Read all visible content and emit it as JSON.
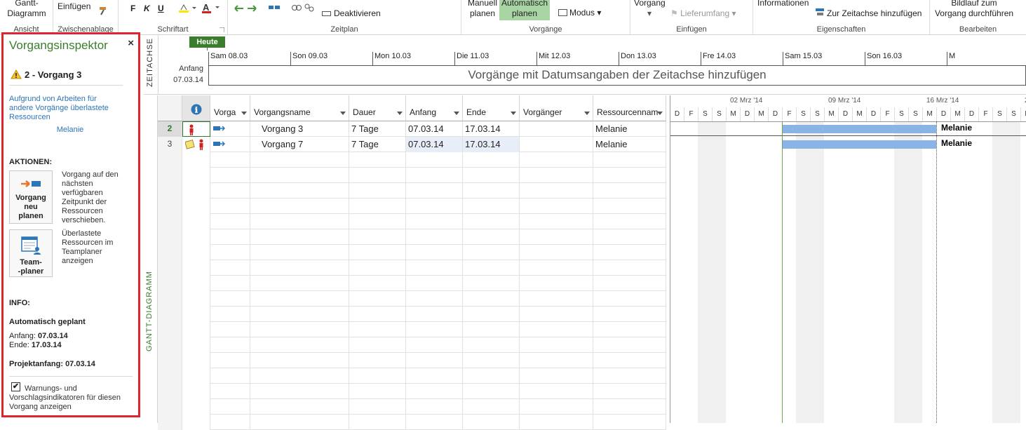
{
  "ribbon": {
    "ansicht": {
      "btn": "Gantt-\nDiagramm",
      "label": "Ansicht"
    },
    "zwischenablage": {
      "btn": "Einfügen",
      "label": "Zwischenablage"
    },
    "schriftart": {
      "b": "F",
      "k": "K",
      "u": "U",
      "label": "Schriftart"
    },
    "zeitplan": {
      "deaktivieren": "Deaktivieren",
      "label": "Zeitplan"
    },
    "vorgaenge": {
      "manuell": "Manuell\nplanen",
      "auto": "Automatisch\nplanen",
      "modus": "Modus",
      "label": "Vorgänge"
    },
    "einfuegen": {
      "vorgang": "Vorgang",
      "lieferumfang": "Lieferumfang",
      "label": "Einfügen"
    },
    "eigenschaften": {
      "info": "Informationen",
      "zeitachse": "Zur Zeitachse hinzufügen",
      "label": "Eigenschaften"
    },
    "bearbeiten": {
      "bildlauf": "Bildlauf zum\nVorgang durchführen",
      "label": "Bearbeiten"
    }
  },
  "inspector": {
    "title": "Vorgangsinspektor",
    "close": "×",
    "task_title": "2 - Vorgang 3",
    "warning_link": "Aufgrund von Arbeiten für andere Vorgänge überlastete Ressourcen",
    "resource": "Melanie",
    "actions_heading": "AKTIONEN:",
    "action1": {
      "label": "Vorgang\nneu\nplanen",
      "desc": "Vorgang auf den nächsten verfügbaren Zeitpunkt der Ressourcen verschieben."
    },
    "action2": {
      "label": "Team-\n-planer",
      "desc": "Überlastete Ressourcen im Teamplaner anzeigen"
    },
    "info_heading": "INFO:",
    "schedule_mode": "Automatisch geplant",
    "start_label": "Anfang:",
    "start_value": "07.03.14",
    "end_label": "Ende:",
    "end_value": "17.03.14",
    "project_start": "Projektanfang: 07.03.14",
    "checkbox_label": "Warnungs- und Vorschlagsindikatoren für diesen Vorgang anzeigen",
    "checkbox_checked": "✔"
  },
  "timeline": {
    "side_label": "ZEITACHSE",
    "today": "Heute",
    "days": [
      "Sam 08.03",
      "Son 09.03",
      "Mon 10.03",
      "Die 11.03",
      "Mit 12.03",
      "Don 13.03",
      "Fre 14.03",
      "Sam 15.03",
      "Son 16.03",
      "M"
    ],
    "start_label": "Anfang",
    "start_date": "07.03.14",
    "placeholder": "Vorgänge mit Datumsangaben der Zeitachse hinzufügen"
  },
  "grid": {
    "side_label": "GANTT-DIAGRAMM",
    "columns": {
      "info": "ℹ",
      "mode": "Vorga",
      "name": "Vorgangsname",
      "duration": "Dauer",
      "start": "Anfang",
      "end": "Ende",
      "pred": "Vorgänger",
      "resource": "Ressourcennam"
    },
    "rows": [
      {
        "id": "2",
        "name": "Vorgang 3",
        "duration": "7 Tage",
        "start": "07.03.14",
        "end": "17.03.14",
        "pred": "",
        "resource": "Melanie"
      },
      {
        "id": "3",
        "name": "Vorgang 7",
        "duration": "7 Tage",
        "start": "07.03.14",
        "end": "17.03.14",
        "pred": "",
        "resource": "Melanie"
      }
    ]
  },
  "gantt": {
    "weeks": [
      "02 Mrz '14",
      "09 Mrz '14",
      "16 Mrz '14",
      "2"
    ],
    "day_letters": [
      "D",
      "F",
      "S",
      "S",
      "M",
      "D",
      "M",
      "D",
      "F",
      "S",
      "S",
      "M",
      "D",
      "M",
      "D",
      "F",
      "S",
      "S",
      "M",
      "D",
      "M",
      "D",
      "F",
      "S",
      "S",
      "M"
    ],
    "bar_labels": [
      "Melanie",
      "Melanie"
    ]
  },
  "colors": {
    "accent_green": "#3a7d2c",
    "highlight": "#e0242f",
    "bar": "#8ab4e6"
  }
}
